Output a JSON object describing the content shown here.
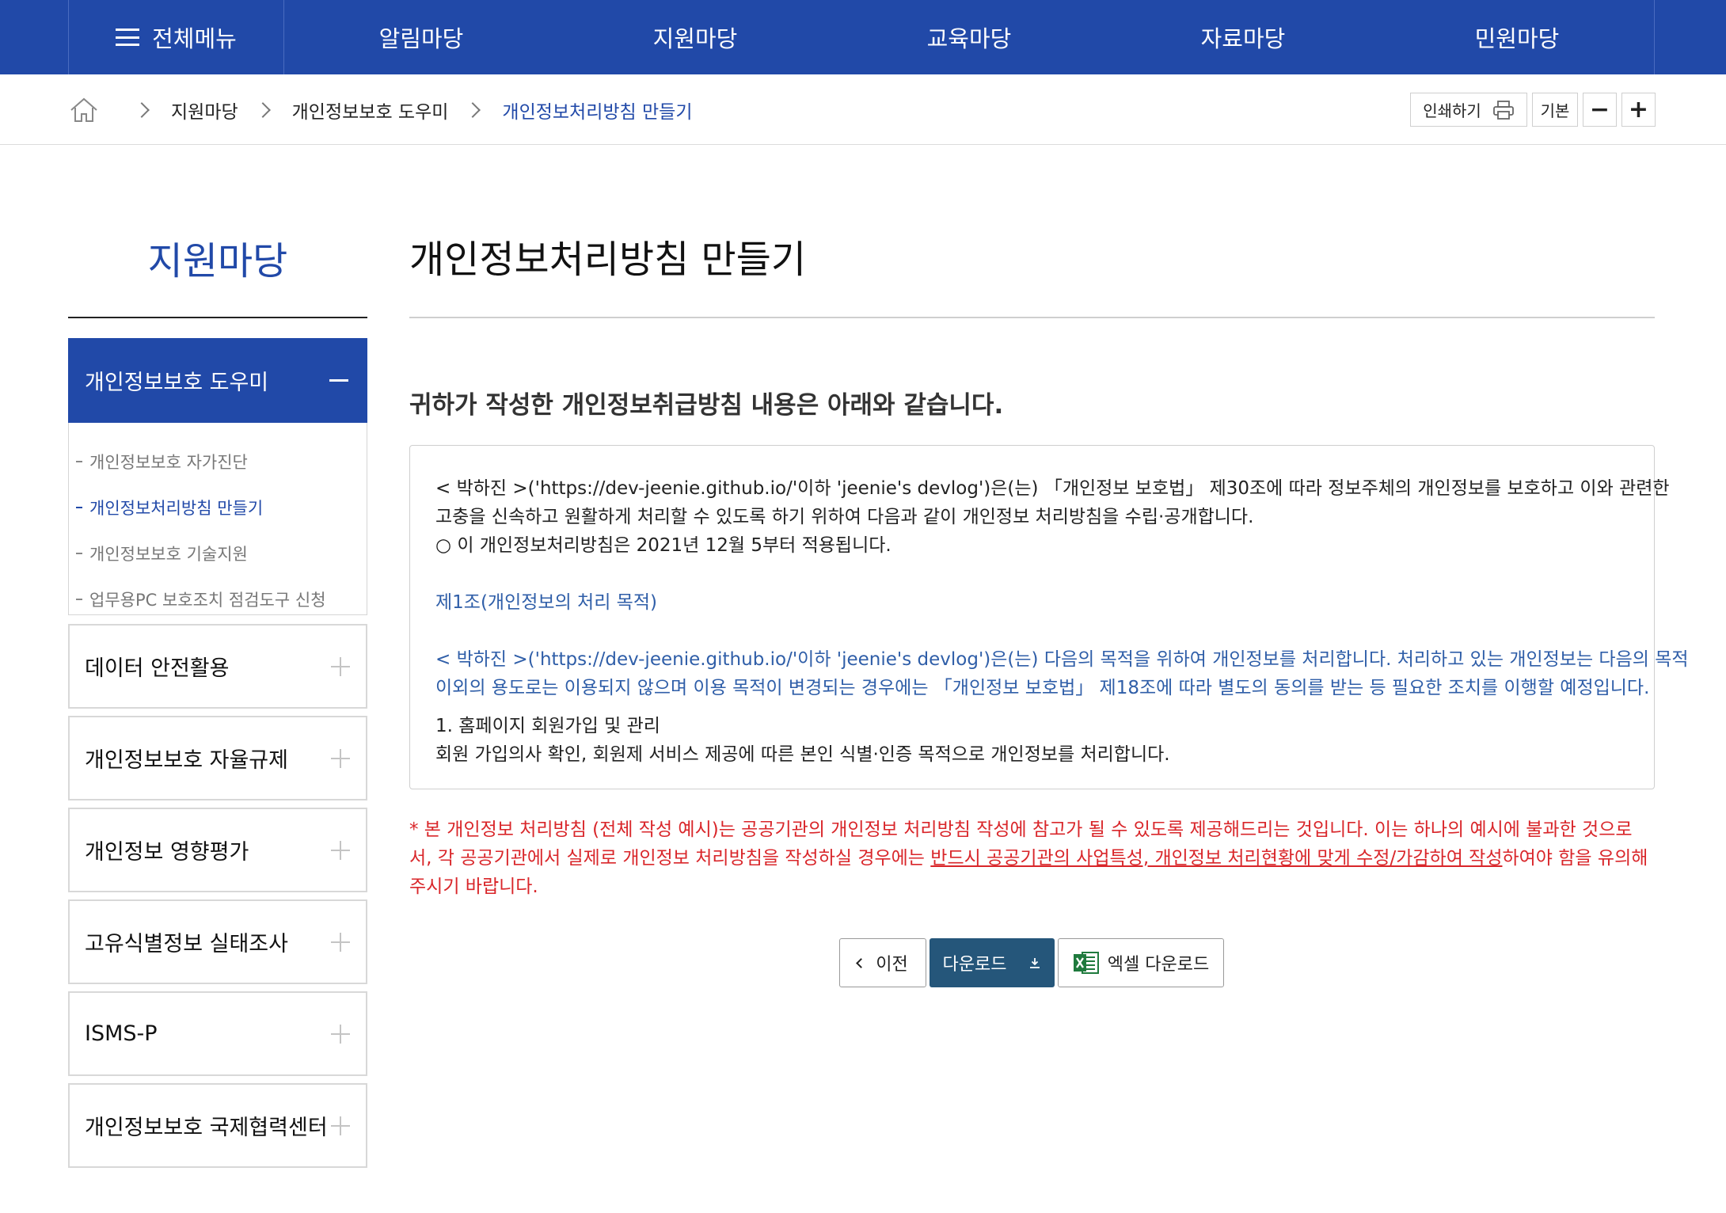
{
  "gnb": {
    "all_menu": "전체메뉴",
    "items": [
      "알림마당",
      "지원마당",
      "교육마당",
      "자료마당",
      "민원마당"
    ]
  },
  "breadcrumb": {
    "items": [
      "지원마당",
      "개인정보보호 도우미",
      "개인정보처리방침 만들기"
    ]
  },
  "tools": {
    "print": "인쇄하기",
    "basic": "기본",
    "minus": "−",
    "plus": "+"
  },
  "sidebar": {
    "title": "지원마당",
    "active": "개인정보보호 도우미",
    "sub_items": [
      "개인정보보호 자가진단",
      "개인정보처리방침 만들기",
      "개인정보보호 기술지원",
      "업무용PC 보호조치 점검도구 신청"
    ],
    "menus": [
      "데이터 안전활용",
      "개인정보보호 자율규제",
      "개인정보 영향평가",
      "고유식별정보 실태조사",
      "ISMS-P",
      "개인정보보호 국제협력센터"
    ]
  },
  "content": {
    "title": "개인정보처리방침 만들기",
    "lead": "귀하가 작성한 개인정보취급방침 내용은 아래와 같습니다.",
    "policy": {
      "p1_line1": "< 박하진 >('https://dev-jeenie.github.io/'이하 'jeenie's devlog')은(는) 「개인정보 보호법」 제30조에 따라 정보주체의 개인정보를 보호하고 이와 관련한",
      "p1_line2": "고충을 신속하고 원활하게 처리할 수 있도록 하기 위하여 다음과 같이 개인정보 처리방침을 수립·공개합니다.",
      "p1_line3": "○ 이 개인정보처리방침은 2021년 12월 5부터 적용됩니다.",
      "article1_title": "제1조(개인정보의 처리 목적)",
      "article1_line1": "< 박하진 >('https://dev-jeenie.github.io/'이하 'jeenie's devlog')은(는) 다음의 목적을 위하여 개인정보를 처리합니다. 처리하고 있는 개인정보는 다음의 목적",
      "article1_line2": "이외의 용도로는 이용되지 않으며 이용 목적이 변경되는 경우에는 「개인정보 보호법」 제18조에 따라 별도의 동의를 받는 등 필요한 조치를 이행할 예정입니다.",
      "item1_title": "1. 홈페이지 회원가입 및 관리",
      "item1_desc": "회원 가입의사 확인, 회원제 서비스 제공에 따른 본인 식별·인증 목적으로 개인정보를 처리합니다."
    },
    "notice": {
      "part1": "* 본 개인정보 처리방침 (전체 작성 예시)는 공공기관의 개인정보 처리방침 작성에 참고가 될 수 있도록 제공해드리는 것입니다. 이는 하나의 예시에 불과한 것으로서, 각 공공기관에서 실제로 개인정보 처리방침을 작성하실 경우에는 ",
      "underlined": "반드시 공공기관의 사업특성, 개인정보 처리현황에 맞게 수정/가감하여 작성",
      "part2": "하여야 함을 유의해 주시기 바랍니다."
    },
    "buttons": {
      "prev": "이전",
      "download": "다운로드",
      "excel": "엑셀 다운로드"
    }
  },
  "colors": {
    "primary": "#2149a8",
    "download_button": "#25567a",
    "notice_red": "#d9262a",
    "policy_blue": "#2f5ea8"
  }
}
